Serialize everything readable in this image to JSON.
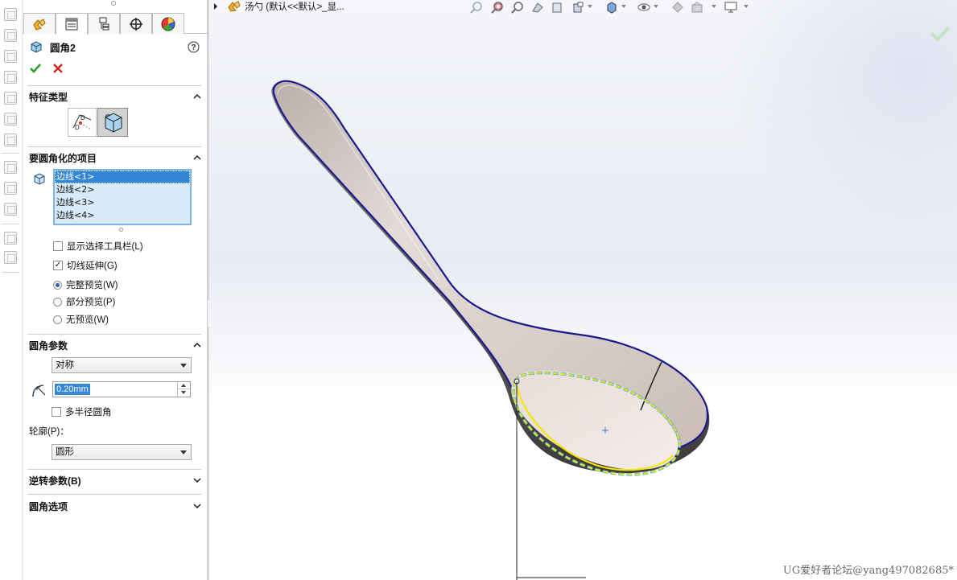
{
  "feature_manager": {
    "tabs": [
      {
        "icon": "feature-tree-icon"
      },
      {
        "icon": "property-manager-icon"
      },
      {
        "icon": "configuration-manager-icon"
      },
      {
        "icon": "dimxpert-icon"
      },
      {
        "icon": "display-manager-icon"
      }
    ],
    "active_tab_index": 1,
    "feature_title": "圆角2",
    "help_icon": "help-icon",
    "ok_icon": "check-icon",
    "cancel_icon": "close-icon"
  },
  "sections": {
    "feature_type": {
      "title": "特征类型",
      "buttons": [
        {
          "icon": "manual-fillet-icon"
        },
        {
          "icon": "fillet-feature-icon"
        }
      ]
    },
    "items_to_fillet": {
      "title": "要圆角化的项目",
      "edges": [
        "边线<1>",
        "边线<2>",
        "边线<3>",
        "边线<4>"
      ],
      "selected_index": 0,
      "show_selection_toolbar": {
        "label": "显示选择工具栏(L)",
        "checked": false
      },
      "tangent_propagation": {
        "label": "切线延伸(G)",
        "checked": true
      },
      "preview_options": [
        {
          "label": "完整预览(W)",
          "selected": true
        },
        {
          "label": "部分预览(P)",
          "selected": false
        },
        {
          "label": "无预览(W)",
          "selected": false
        }
      ]
    },
    "fillet_parameters": {
      "title": "圆角参数",
      "method": "对称",
      "radius_value": "0.20mm",
      "multi_radius": {
        "label": "多半径圆角",
        "checked": false
      },
      "profile_label": "轮廓(P)：",
      "profile_value": "圆形"
    },
    "setback_parameters": {
      "title": "逆转参数(B)"
    },
    "fillet_options": {
      "title": "圆角选项"
    }
  },
  "viewport": {
    "breadcrumb": "汤勺  (默认<<默认>_显...",
    "confirm_icon": "check-icon",
    "watermark": "UG爱好者论坛@yang497082685*"
  },
  "colors": {
    "accent_blue": "#3385d6",
    "selection_list_bg": "#d8e9f8",
    "edge_highlight_yellow": "#f4e600",
    "edge_highlight_cyan": "#4db6e6",
    "model_edge_blue": "#1a1a8c"
  }
}
